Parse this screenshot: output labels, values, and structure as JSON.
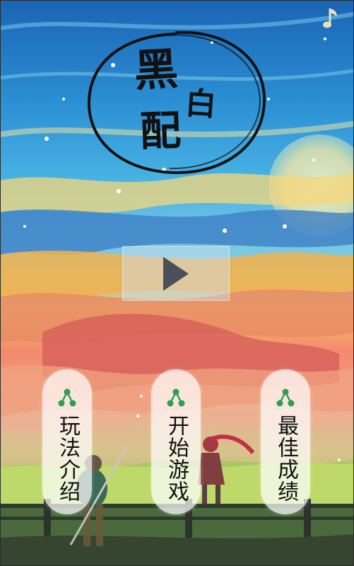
{
  "title": {
    "char1": "黑",
    "char2": "白",
    "char3": "配"
  },
  "menu": [
    {
      "label": "玩法介绍",
      "icon": "share-icon"
    },
    {
      "label": "开始游戏",
      "icon": "share-icon"
    },
    {
      "label": "最佳成绩",
      "icon": "share-icon"
    }
  ],
  "icons": {
    "music": "music-note-icon",
    "play": "play-triangle-icon"
  },
  "colors": {
    "menu_icon_green": "#2e9e4f",
    "logo_ink": "#111111"
  }
}
